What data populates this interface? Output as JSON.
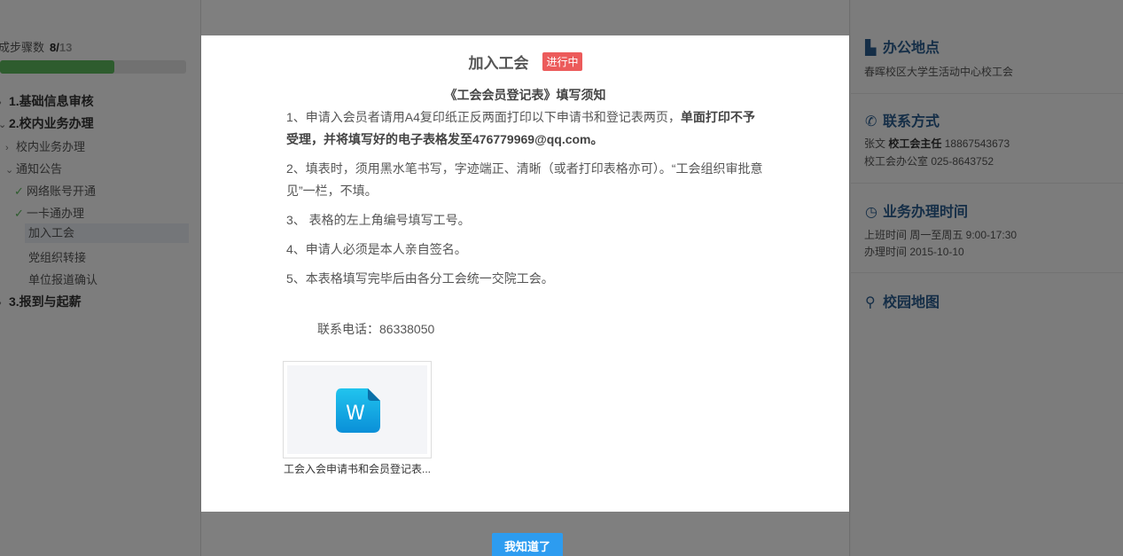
{
  "progress": {
    "label": "成步骤数",
    "current": "8/",
    "total": "13",
    "fraction": 0.615
  },
  "nav": {
    "s1": "1.基础信息审核",
    "s2": "2.校内业务办理",
    "s2_sub1": "校内业务办理",
    "s2_sub2": "通知公告",
    "s2_items": [
      "网络账号开通",
      "一卡通办理",
      "加入工会",
      "党组织转接",
      "单位报道确认"
    ],
    "s3": "3.报到与起薪"
  },
  "right": {
    "office_title": "办公地点",
    "office_text": "春晖校区大学生活动中心校工会",
    "contact_title": "联系方式",
    "contact_name": "张文",
    "contact_role": "校工会主任",
    "contact_phone": "18867543673",
    "contact_office": "校工会办公室 025-8643752",
    "hours_title": "业务办理时间",
    "hours_work": "上班时间 周一至周五 9:00-17:30",
    "hours_date": "办理时间 2015-10-10",
    "map_title": "校园地图"
  },
  "modal": {
    "title": "加入工会",
    "status": "进行中",
    "notice_title": "《工会会员登记表》填写须知",
    "item1_a": "1、申请入会员者请用A4复印纸正反两面打印以下申请书和登记表两页，",
    "item1_b": "单面打印不予受理，并将填写好的电子表格发至476779969@qq.com。",
    "item2": "2、填表时，须用黑水笔书写，字迹端正、清晰（或者打印表格亦可）。“工会组织审批意见”一栏，不填。",
    "item3": "3、 表格的左上角编号填写工号。",
    "item4": "4、申请人必须是本人亲自签名。",
    "item5": "5、本表格填写完毕后由各分工会统一交院工会。",
    "phone": "联系电话：86338050",
    "file_name": "工会入会申请书和会员登记表...",
    "file_icon": "word-doc-icon",
    "confirm": "我知道了"
  },
  "colors": {
    "accent": "#2d9cf0",
    "badge": "#ec5b5b",
    "progress": "#5cb85c",
    "heading": "#2a5d8f"
  }
}
